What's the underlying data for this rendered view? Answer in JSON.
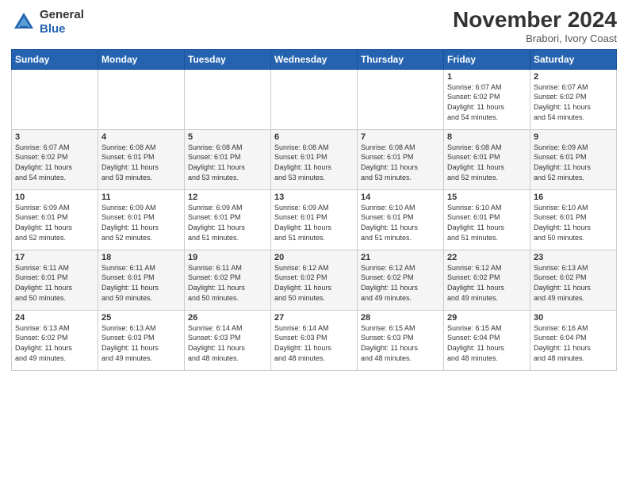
{
  "header": {
    "logo_general": "General",
    "logo_blue": "Blue",
    "month_title": "November 2024",
    "location": "Brabori, Ivory Coast"
  },
  "days_of_week": [
    "Sunday",
    "Monday",
    "Tuesday",
    "Wednesday",
    "Thursday",
    "Friday",
    "Saturday"
  ],
  "weeks": [
    [
      {
        "day": "",
        "info": ""
      },
      {
        "day": "",
        "info": ""
      },
      {
        "day": "",
        "info": ""
      },
      {
        "day": "",
        "info": ""
      },
      {
        "day": "",
        "info": ""
      },
      {
        "day": "1",
        "info": "Sunrise: 6:07 AM\nSunset: 6:02 PM\nDaylight: 11 hours\nand 54 minutes."
      },
      {
        "day": "2",
        "info": "Sunrise: 6:07 AM\nSunset: 6:02 PM\nDaylight: 11 hours\nand 54 minutes."
      }
    ],
    [
      {
        "day": "3",
        "info": "Sunrise: 6:07 AM\nSunset: 6:02 PM\nDaylight: 11 hours\nand 54 minutes."
      },
      {
        "day": "4",
        "info": "Sunrise: 6:08 AM\nSunset: 6:01 PM\nDaylight: 11 hours\nand 53 minutes."
      },
      {
        "day": "5",
        "info": "Sunrise: 6:08 AM\nSunset: 6:01 PM\nDaylight: 11 hours\nand 53 minutes."
      },
      {
        "day": "6",
        "info": "Sunrise: 6:08 AM\nSunset: 6:01 PM\nDaylight: 11 hours\nand 53 minutes."
      },
      {
        "day": "7",
        "info": "Sunrise: 6:08 AM\nSunset: 6:01 PM\nDaylight: 11 hours\nand 53 minutes."
      },
      {
        "day": "8",
        "info": "Sunrise: 6:08 AM\nSunset: 6:01 PM\nDaylight: 11 hours\nand 52 minutes."
      },
      {
        "day": "9",
        "info": "Sunrise: 6:09 AM\nSunset: 6:01 PM\nDaylight: 11 hours\nand 52 minutes."
      }
    ],
    [
      {
        "day": "10",
        "info": "Sunrise: 6:09 AM\nSunset: 6:01 PM\nDaylight: 11 hours\nand 52 minutes."
      },
      {
        "day": "11",
        "info": "Sunrise: 6:09 AM\nSunset: 6:01 PM\nDaylight: 11 hours\nand 52 minutes."
      },
      {
        "day": "12",
        "info": "Sunrise: 6:09 AM\nSunset: 6:01 PM\nDaylight: 11 hours\nand 51 minutes."
      },
      {
        "day": "13",
        "info": "Sunrise: 6:09 AM\nSunset: 6:01 PM\nDaylight: 11 hours\nand 51 minutes."
      },
      {
        "day": "14",
        "info": "Sunrise: 6:10 AM\nSunset: 6:01 PM\nDaylight: 11 hours\nand 51 minutes."
      },
      {
        "day": "15",
        "info": "Sunrise: 6:10 AM\nSunset: 6:01 PM\nDaylight: 11 hours\nand 51 minutes."
      },
      {
        "day": "16",
        "info": "Sunrise: 6:10 AM\nSunset: 6:01 PM\nDaylight: 11 hours\nand 50 minutes."
      }
    ],
    [
      {
        "day": "17",
        "info": "Sunrise: 6:11 AM\nSunset: 6:01 PM\nDaylight: 11 hours\nand 50 minutes."
      },
      {
        "day": "18",
        "info": "Sunrise: 6:11 AM\nSunset: 6:01 PM\nDaylight: 11 hours\nand 50 minutes."
      },
      {
        "day": "19",
        "info": "Sunrise: 6:11 AM\nSunset: 6:02 PM\nDaylight: 11 hours\nand 50 minutes."
      },
      {
        "day": "20",
        "info": "Sunrise: 6:12 AM\nSunset: 6:02 PM\nDaylight: 11 hours\nand 50 minutes."
      },
      {
        "day": "21",
        "info": "Sunrise: 6:12 AM\nSunset: 6:02 PM\nDaylight: 11 hours\nand 49 minutes."
      },
      {
        "day": "22",
        "info": "Sunrise: 6:12 AM\nSunset: 6:02 PM\nDaylight: 11 hours\nand 49 minutes."
      },
      {
        "day": "23",
        "info": "Sunrise: 6:13 AM\nSunset: 6:02 PM\nDaylight: 11 hours\nand 49 minutes."
      }
    ],
    [
      {
        "day": "24",
        "info": "Sunrise: 6:13 AM\nSunset: 6:02 PM\nDaylight: 11 hours\nand 49 minutes."
      },
      {
        "day": "25",
        "info": "Sunrise: 6:13 AM\nSunset: 6:03 PM\nDaylight: 11 hours\nand 49 minutes."
      },
      {
        "day": "26",
        "info": "Sunrise: 6:14 AM\nSunset: 6:03 PM\nDaylight: 11 hours\nand 48 minutes."
      },
      {
        "day": "27",
        "info": "Sunrise: 6:14 AM\nSunset: 6:03 PM\nDaylight: 11 hours\nand 48 minutes."
      },
      {
        "day": "28",
        "info": "Sunrise: 6:15 AM\nSunset: 6:03 PM\nDaylight: 11 hours\nand 48 minutes."
      },
      {
        "day": "29",
        "info": "Sunrise: 6:15 AM\nSunset: 6:04 PM\nDaylight: 11 hours\nand 48 minutes."
      },
      {
        "day": "30",
        "info": "Sunrise: 6:16 AM\nSunset: 6:04 PM\nDaylight: 11 hours\nand 48 minutes."
      }
    ]
  ]
}
